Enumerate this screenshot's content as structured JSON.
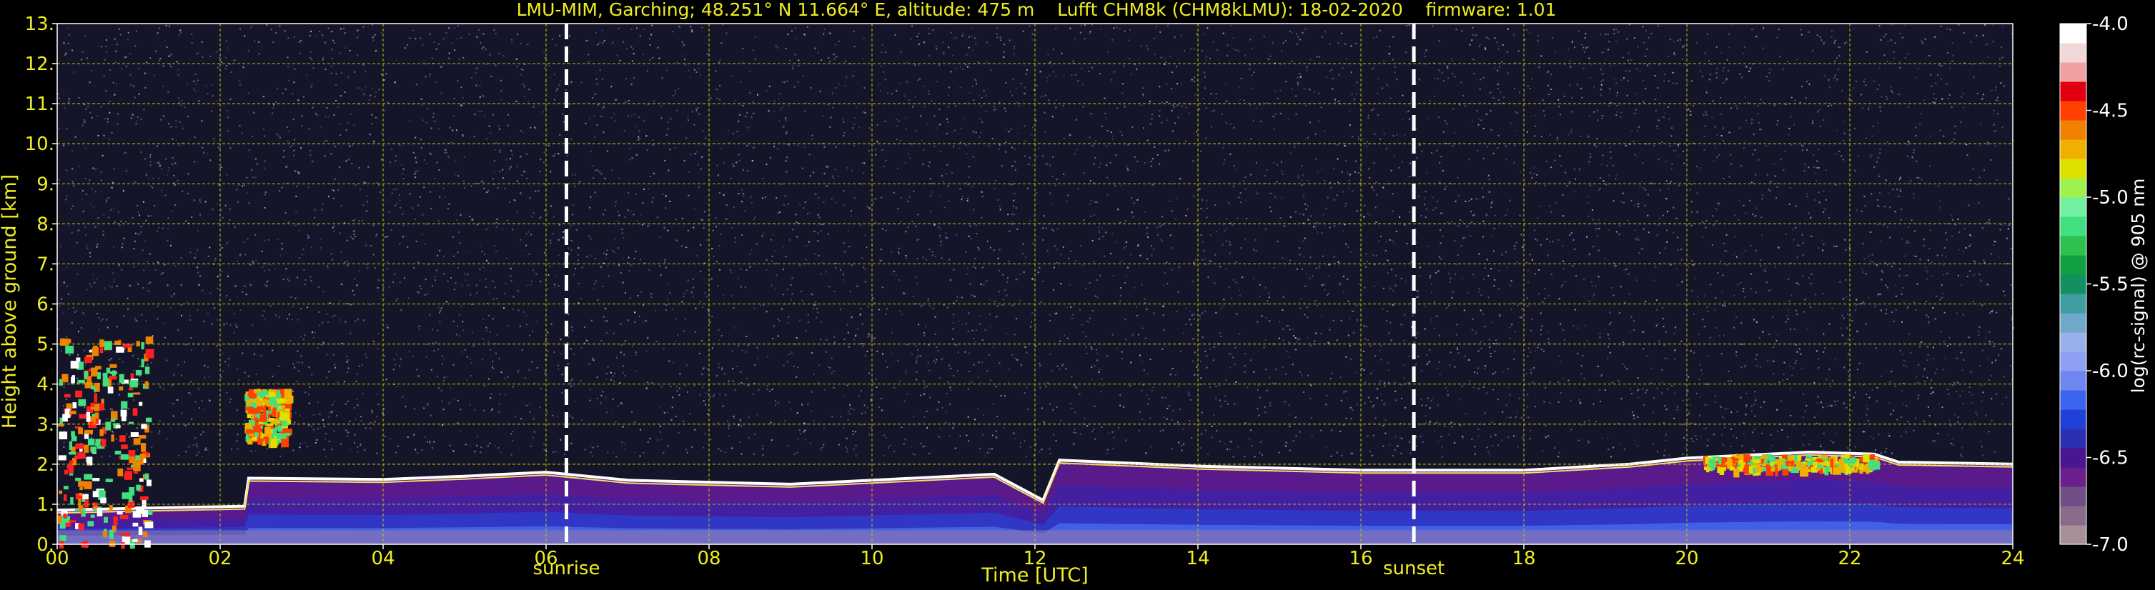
{
  "chart_data": {
    "type": "heatmap",
    "title": "LMU-MIM, Garching; 48.251° N 11.664° E, altitude: 475 m    Lufft CHM8k (CHM8kLMU): 18-02-2020    firmware: 1.01",
    "xlabel": "Time [UTC]",
    "ylabel": "Height above ground [km]",
    "x_ticks": [
      "00",
      "02",
      "04",
      "06",
      "08",
      "10",
      "12",
      "14",
      "16",
      "18",
      "20",
      "22",
      "24"
    ],
    "y_ticks": [
      "0.",
      "1.",
      "2.",
      "3.",
      "4.",
      "5.",
      "6.",
      "7.",
      "8.",
      "9.",
      "10.",
      "11.",
      "12.",
      "13."
    ],
    "xlim": [
      0,
      24
    ],
    "ylim": [
      0,
      13
    ],
    "grid": true,
    "markers": [
      {
        "label": "sunrise",
        "x": 6.25
      },
      {
        "label": "sunset",
        "x": 16.65
      }
    ],
    "colorbar": {
      "label": "log(rc-signal) @ 905 nm",
      "ticks": [
        "-4.0",
        "-4.5",
        "-5.0",
        "-5.5",
        "-6.0",
        "-6.5",
        "-7.0"
      ],
      "range": [
        -7.0,
        -4.0
      ],
      "colors": [
        "#a8909a",
        "#8a6b8b",
        "#6f4d85",
        "#6a1f8c",
        "#4a1590",
        "#2b2fb0",
        "#2040d8",
        "#3c64ee",
        "#6f86f0",
        "#8fa0f2",
        "#9ab0ea",
        "#6fa9c8",
        "#3f9ea0",
        "#149060",
        "#10a040",
        "#30c050",
        "#40e080",
        "#70f0a0",
        "#a0f050",
        "#e0e000",
        "#f0b000",
        "#f08000",
        "#ff4000",
        "#e00010",
        "#f0a0a0",
        "#f0d8d8",
        "#ffffff"
      ]
    },
    "boundary_layer_top_km": [
      [
        0.0,
        0.85
      ],
      [
        1.0,
        0.9
      ],
      [
        2.3,
        0.95
      ],
      [
        2.35,
        1.65
      ],
      [
        4.0,
        1.62
      ],
      [
        5.0,
        1.7
      ],
      [
        5.5,
        1.75
      ],
      [
        6.0,
        1.8
      ],
      [
        7.0,
        1.6
      ],
      [
        9.0,
        1.5
      ],
      [
        10.5,
        1.65
      ],
      [
        11.5,
        1.75
      ],
      [
        12.1,
        1.1
      ],
      [
        12.3,
        2.1
      ],
      [
        14.0,
        1.95
      ],
      [
        16.0,
        1.85
      ],
      [
        18.0,
        1.85
      ],
      [
        19.3,
        2.0
      ],
      [
        20.0,
        2.15
      ],
      [
        21.5,
        2.3
      ],
      [
        22.3,
        2.25
      ],
      [
        22.6,
        2.05
      ],
      [
        24.0,
        2.0
      ]
    ],
    "cloud_features": [
      {
        "x_start": 0.0,
        "x_end": 1.1,
        "base_km": 0.0,
        "top_km": 5.2,
        "level": "-4.0"
      },
      {
        "x_start": 2.3,
        "x_end": 2.8,
        "base_km": 2.6,
        "top_km": 3.9,
        "level": "-5.0"
      },
      {
        "x_start": 20.2,
        "x_end": 22.3,
        "base_km": 1.9,
        "top_km": 2.25,
        "level": "-5.0"
      }
    ]
  }
}
